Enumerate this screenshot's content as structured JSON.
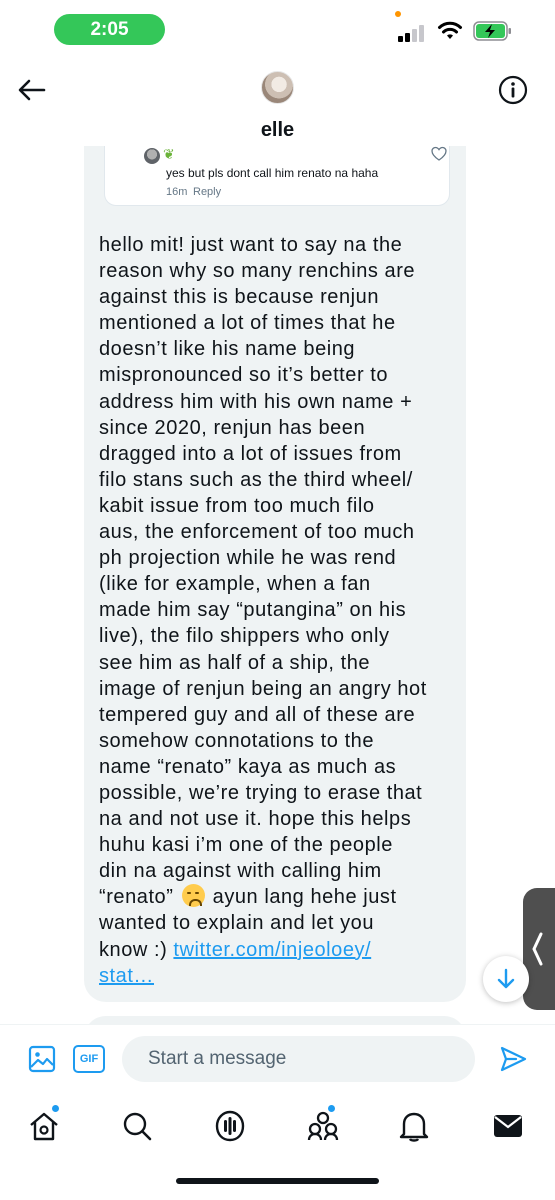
{
  "status_bar": {
    "time": "2:05",
    "icons": [
      "signal-icon",
      "wifi-icon",
      "battery-charging-icon"
    ],
    "colors": {
      "time_pill": "#34c759",
      "privacy_dot": "#ff9500"
    }
  },
  "header": {
    "contact_name": "elle",
    "back_icon": "arrow-left-icon",
    "info_icon": "info-icon"
  },
  "quoted_reply": {
    "text": "yes but pls dont call him renato na haha",
    "time": "16m",
    "reply_label": "Reply",
    "like_icon": "heart-outline-icon"
  },
  "message": {
    "lines": [
      "hello mit! just want to say na the",
      "reason why so many renchins are",
      "against this is because renjun",
      "mentioned a lot of times that he",
      "doesn’t like his name being",
      "mispronounced so it’s better to",
      "address him with his own name +",
      "since 2020, renjun has been",
      "dragged into a lot of issues from",
      "filo stans such as the third wheel/",
      "kabit issue from too much filo",
      "aus, the enforcement of too much",
      "ph projection while he was rend",
      "(like for example, when a fan",
      "made him say “putangina” on his",
      "live), the filo shippers who only",
      "see him as half of a ship, the",
      "image of renjun being an angry hot",
      "tempered guy and all of these are",
      "somehow connotations to the",
      "name “renato” kaya as much as",
      "possible, we’re trying to erase that",
      "na and not use it. hope this helps",
      "huhu kasi i’m one of the people",
      "din na against with calling him"
    ],
    "line_26_before": "“renato”",
    "line_26_after": "ayun lang hehe just",
    "line_27": "wanted to explain and let you",
    "line_28_prefix": "know :) ",
    "link_part_1": "twitter.com/injeoloey/",
    "link_part_2": "stat…",
    "emoji": "disappointed-face-emoji"
  },
  "scroll_button": {
    "icon": "arrow-down-icon"
  },
  "composer": {
    "placeholder": "Start a message",
    "gif_label": "GIF",
    "image_icon": "image-icon",
    "send_icon": "send-icon"
  },
  "bottom_nav": {
    "items": [
      "home-icon",
      "search-icon",
      "spaces-icon",
      "communities-icon",
      "notifications-icon",
      "messages-icon"
    ],
    "accent": "#1d9bf0"
  }
}
